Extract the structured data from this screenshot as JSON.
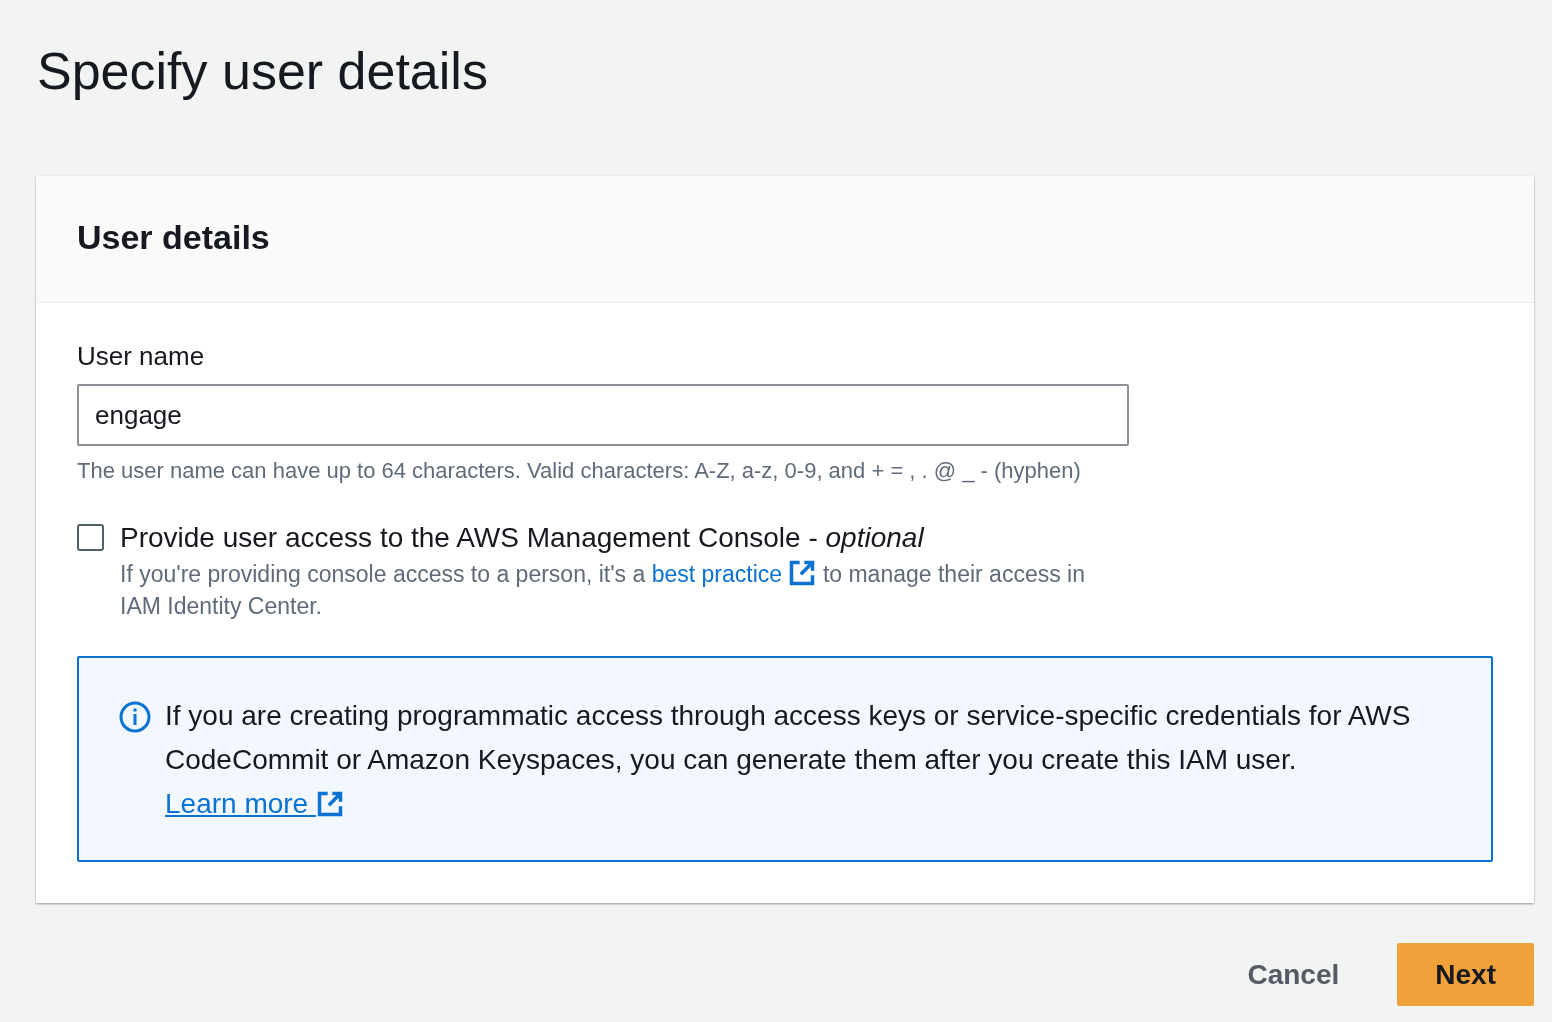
{
  "page_title": "Specify user details",
  "panel": {
    "title": "User details",
    "user_name": {
      "label": "User name",
      "value": "engage",
      "hint": "The user name can have up to 64 characters. Valid characters: A-Z, a-z, 0-9, and + = , . @ _ - (hyphen)"
    },
    "console_access": {
      "label": "Provide user access to the AWS Management Console - *optional*",
      "checked": false,
      "description_before": "If you're providing console access to a person, it's a",
      "link": "best practice",
      "description_after": "to manage their access in IAM Identity Center."
    },
    "info": {
      "text": "If you are creating programmatic access through access keys or service-specific credentials for AWS CodeCommit or Amazon Keyspaces, you can generate them after you create this IAM user.",
      "link": "Learn more"
    }
  },
  "buttons": [
    {
      "label": "Cancel",
      "kind": "link"
    },
    {
      "label": "Next",
      "kind": "primary"
    }
  ]
}
